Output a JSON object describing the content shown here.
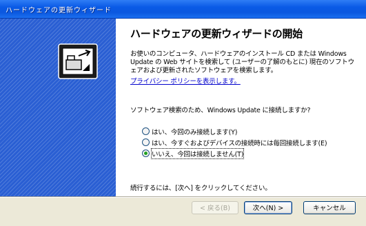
{
  "window": {
    "title": "ハードウェアの更新ウィザード"
  },
  "main": {
    "heading": "ハードウェアの更新ウィザードの開始",
    "description_lines": [
      "お使いのコンピュータ、ハードウェアのインストール CD または Windows",
      "Update の Web サイトを検索して (ユーザーの了解のもとに) 現在のソフトウ",
      "ェアおよび更新されたソフトウェアを検索します。"
    ],
    "privacy_link": "プライバシー ポリシーを表示します。",
    "question": "ソフトウェア検索のため、Windows Update に接続しますか?",
    "options": [
      {
        "label": "はい、今回のみ接続します(Y)",
        "checked": false
      },
      {
        "label": "はい、今すぐおよびデバイスの接続時には毎回接続します(E)",
        "checked": false
      },
      {
        "label": "いいえ、今回は接続しません(T)",
        "checked": true
      }
    ],
    "continue_text": "続行するには、[次へ] をクリックしてください。"
  },
  "buttons": {
    "back": "< 戻る(B)",
    "next": "次へ(N) >",
    "cancel": "キャンセル"
  },
  "colors": {
    "title_bar": "#0a5ae6",
    "side_panel": "#2a5fd3",
    "link": "#0000cc",
    "dialog_background": "#ece9d8"
  },
  "icons": {
    "wizard": "hardware-wizard-icon"
  }
}
